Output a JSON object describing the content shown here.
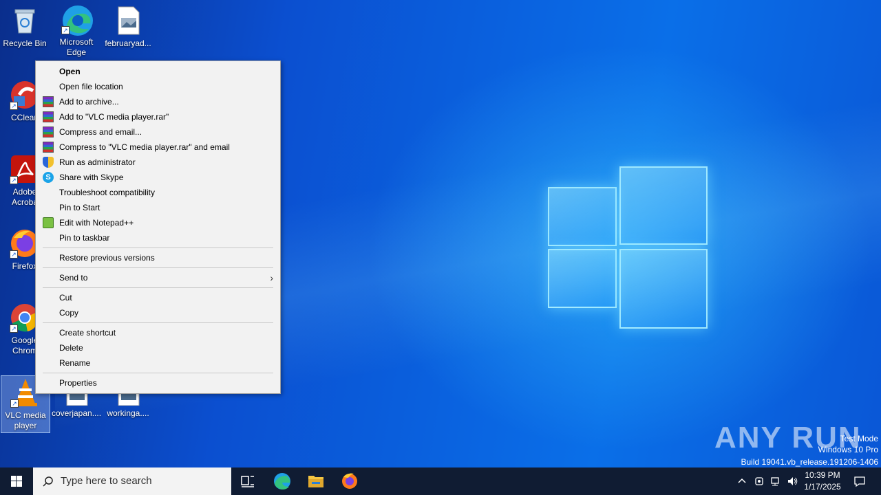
{
  "desktop_icons": [
    {
      "label": "Recycle Bin"
    },
    {
      "label": "Microsoft Edge"
    },
    {
      "label": "februaryad..."
    },
    {
      "label": "CClean"
    },
    {
      "label": "Adobe Acroba"
    },
    {
      "label": "Firefox"
    },
    {
      "label": "Google Chrom"
    },
    {
      "label": "VLC media player"
    },
    {
      "label": "coverjapan...."
    },
    {
      "label": "workinga...."
    }
  ],
  "context_menu": {
    "items": [
      {
        "label": "Open"
      },
      {
        "label": "Open file location"
      },
      {
        "label": "Add to archive..."
      },
      {
        "label": "Add to \"VLC media player.rar\""
      },
      {
        "label": "Compress and email..."
      },
      {
        "label": "Compress to \"VLC media player.rar\" and email"
      },
      {
        "label": "Run as administrator"
      },
      {
        "label": "Share with Skype"
      },
      {
        "label": "Troubleshoot compatibility"
      },
      {
        "label": "Pin to Start"
      },
      {
        "label": "Edit with Notepad++"
      },
      {
        "label": "Pin to taskbar"
      },
      {
        "label": "Restore previous versions"
      },
      {
        "label": "Send to"
      },
      {
        "label": "Cut"
      },
      {
        "label": "Copy"
      },
      {
        "label": "Create shortcut"
      },
      {
        "label": "Delete"
      },
      {
        "label": "Rename"
      },
      {
        "label": "Properties"
      }
    ]
  },
  "watermark": {
    "brand": "ANY RUN",
    "line1": "Test Mode",
    "line2": "Windows 10 Pro",
    "line3": "Build 19041.vb_release.191206-1406"
  },
  "taskbar": {
    "search_placeholder": "Type here to search",
    "time": "10:39 PM",
    "date": "1/17/2025"
  }
}
